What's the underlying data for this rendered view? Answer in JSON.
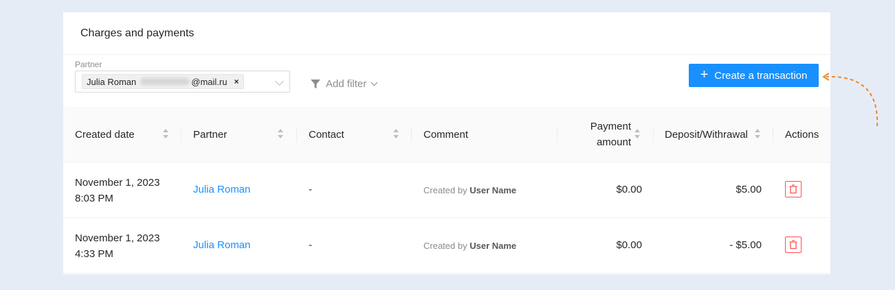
{
  "title": "Charges and payments",
  "filters": {
    "partner_label": "Partner",
    "partner_tag_name": "Julia Roman",
    "partner_tag_email_suffix": "@mail.ru",
    "add_filter_label": "Add filter"
  },
  "actions": {
    "create_label": "Create a transaction"
  },
  "table": {
    "columns": [
      {
        "label": "Created date"
      },
      {
        "label": "Partner"
      },
      {
        "label": "Contact"
      },
      {
        "label": "Comment"
      },
      {
        "label_line1": "Payment",
        "label_line2": "amount"
      },
      {
        "label": "Deposit/Withrawal"
      },
      {
        "label": "Actions"
      }
    ],
    "rows": [
      {
        "date": "November 1, 2023",
        "time": "8:03 PM",
        "partner": "Julia Roman",
        "contact": "-",
        "comment_prefix": "Created by",
        "comment_user": "User Name",
        "payment_amount": "$0.00",
        "deposit_withdrawal": "$5.00"
      },
      {
        "date": "November 1, 2023",
        "time": "4:33 PM",
        "partner": "Julia Roman",
        "contact": "-",
        "comment_prefix": "Created by",
        "comment_user": "User Name",
        "payment_amount": "$0.00",
        "deposit_withdrawal": "- $5.00"
      }
    ]
  },
  "colors": {
    "primary": "#1890ff",
    "danger": "#ff4d4f",
    "annotation_arrow": "#e8892f",
    "background": "#e6ecf5"
  },
  "icons": {
    "filter": "filter-icon",
    "plus": "plus-icon",
    "delete": "trash-icon",
    "sort": "sort-icon"
  }
}
